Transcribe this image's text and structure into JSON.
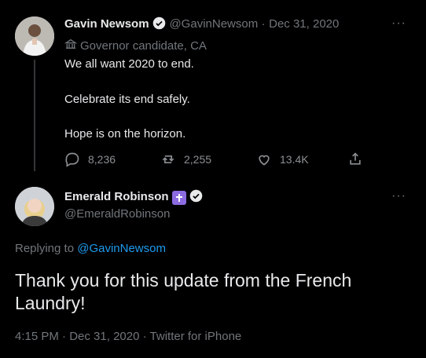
{
  "tweet1": {
    "author_name": "Gavin Newsom",
    "handle": "@GavinNewsom",
    "separator": "·",
    "date": "Dec 31, 2020",
    "label": "Governor candidate, CA",
    "lines": [
      "We all want 2020 to end.",
      "Celebrate its end safely.",
      "Hope is on the horizon."
    ],
    "actions": {
      "replies": "8,236",
      "retweets": "2,255",
      "likes": "13.4K"
    },
    "more": "···"
  },
  "tweet2": {
    "author_name": "Emerald Robinson",
    "handle": "@EmeraldRobinson",
    "replying_prefix": "Replying to",
    "replying_to": "@GavinNewsom",
    "text": "Thank you for this update from the French Laundry!",
    "time": "4:15 PM",
    "date": "Dec 31, 2020",
    "source": "Twitter for iPhone",
    "more": "···"
  },
  "colors": {
    "background": "#000000",
    "link": "#1d9bf0",
    "muted": "#71767b"
  },
  "icons": [
    "verified-badge-icon",
    "government-building-icon",
    "reply-icon",
    "retweet-icon",
    "like-icon",
    "share-icon",
    "more-icon",
    "cross-icon"
  ]
}
